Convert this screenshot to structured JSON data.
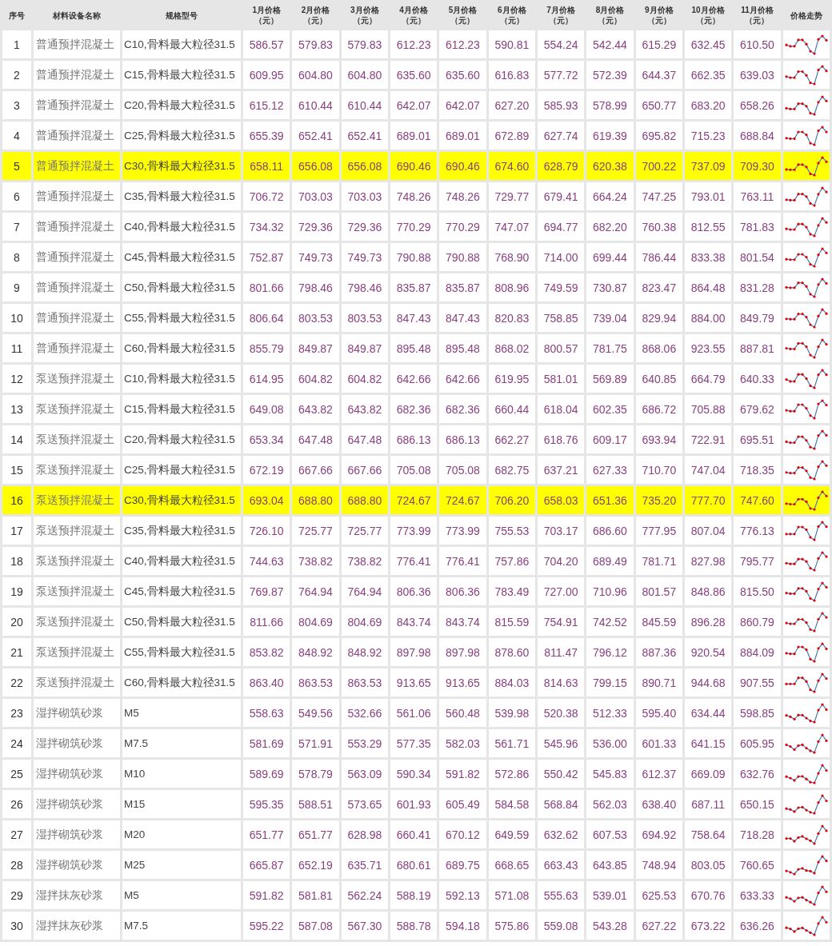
{
  "table": {
    "columns": [
      "序号",
      "材料设备名称",
      "规格型号",
      "1月价格（元）",
      "2月价格（元）",
      "3月价格（元）",
      "4月价格（元）",
      "5月价格（元）",
      "6月价格（元）",
      "7月价格（元）",
      "8月价格（元）",
      "9月价格（元）",
      "10月价格（元）",
      "11月价格（元）",
      "价格走势"
    ],
    "rows": [
      {
        "no": "1",
        "name": "普通预拌混凝土",
        "spec": "C10,骨料最大粒径31.5",
        "highlighted": false,
        "prices": [
          "586.57",
          "579.83",
          "579.83",
          "612.23",
          "612.23",
          "590.81",
          "554.24",
          "542.44",
          "615.29",
          "632.45",
          "610.50"
        ]
      },
      {
        "no": "2",
        "name": "普通预拌混凝土",
        "spec": "C15,骨料最大粒径31.5",
        "highlighted": false,
        "prices": [
          "609.95",
          "604.80",
          "604.80",
          "635.60",
          "635.60",
          "616.83",
          "577.72",
          "572.39",
          "644.37",
          "662.35",
          "639.03"
        ]
      },
      {
        "no": "3",
        "name": "普通预拌混凝土",
        "spec": "C20,骨料最大粒径31.5",
        "highlighted": false,
        "prices": [
          "615.12",
          "610.44",
          "610.44",
          "642.07",
          "642.07",
          "627.20",
          "585.93",
          "578.99",
          "650.77",
          "683.20",
          "658.26"
        ]
      },
      {
        "no": "4",
        "name": "普通预拌混凝土",
        "spec": "C25,骨料最大粒径31.5",
        "highlighted": false,
        "prices": [
          "655.39",
          "652.41",
          "652.41",
          "689.01",
          "689.01",
          "672.89",
          "627.74",
          "619.39",
          "695.82",
          "715.23",
          "688.84"
        ]
      },
      {
        "no": "5",
        "name": "普通预拌混凝土",
        "spec": "C30,骨料最大粒径31.5",
        "highlighted": true,
        "prices": [
          "658.11",
          "656.08",
          "656.08",
          "690.46",
          "690.46",
          "674.60",
          "628.79",
          "620.38",
          "700.22",
          "737.09",
          "709.30"
        ]
      },
      {
        "no": "6",
        "name": "普通预拌混凝土",
        "spec": "C35,骨料最大粒径31.5",
        "highlighted": false,
        "prices": [
          "706.72",
          "703.03",
          "703.03",
          "748.26",
          "748.26",
          "729.77",
          "679.41",
          "664.24",
          "747.25",
          "793.01",
          "763.11"
        ]
      },
      {
        "no": "7",
        "name": "普通预拌混凝土",
        "spec": "C40,骨料最大粒径31.5",
        "highlighted": false,
        "prices": [
          "734.32",
          "729.36",
          "729.36",
          "770.29",
          "770.29",
          "747.07",
          "694.77",
          "682.20",
          "760.38",
          "812.55",
          "781.83"
        ]
      },
      {
        "no": "8",
        "name": "普通预拌混凝土",
        "spec": "C45,骨料最大粒径31.5",
        "highlighted": false,
        "prices": [
          "752.87",
          "749.73",
          "749.73",
          "790.88",
          "790.88",
          "768.90",
          "714.00",
          "699.44",
          "786.44",
          "833.38",
          "801.54"
        ]
      },
      {
        "no": "9",
        "name": "普通预拌混凝土",
        "spec": "C50,骨料最大粒径31.5",
        "highlighted": false,
        "prices": [
          "801.66",
          "798.46",
          "798.46",
          "835.87",
          "835.87",
          "808.96",
          "749.59",
          "730.87",
          "823.47",
          "864.48",
          "831.28"
        ]
      },
      {
        "no": "10",
        "name": "普通预拌混凝土",
        "spec": "C55,骨料最大粒径31.5",
        "highlighted": false,
        "prices": [
          "806.64",
          "803.53",
          "803.53",
          "847.43",
          "847.43",
          "820.83",
          "758.85",
          "739.04",
          "829.94",
          "884.00",
          "849.79"
        ]
      },
      {
        "no": "11",
        "name": "普通预拌混凝土",
        "spec": "C60,骨料最大粒径31.5",
        "highlighted": false,
        "prices": [
          "855.79",
          "849.87",
          "849.87",
          "895.48",
          "895.48",
          "868.02",
          "800.57",
          "781.75",
          "868.06",
          "923.55",
          "887.81"
        ]
      },
      {
        "no": "12",
        "name": "泵送预拌混凝土",
        "spec": "C10,骨料最大粒径31.5",
        "highlighted": false,
        "prices": [
          "614.95",
          "604.82",
          "604.82",
          "642.66",
          "642.66",
          "619.95",
          "581.01",
          "569.89",
          "640.85",
          "664.79",
          "640.33"
        ]
      },
      {
        "no": "13",
        "name": "泵送预拌混凝土",
        "spec": "C15,骨料最大粒径31.5",
        "highlighted": false,
        "prices": [
          "649.08",
          "643.82",
          "643.82",
          "682.36",
          "682.36",
          "660.44",
          "618.04",
          "602.35",
          "686.72",
          "705.88",
          "679.62"
        ]
      },
      {
        "no": "14",
        "name": "泵送预拌混凝土",
        "spec": "C20,骨料最大粒径31.5",
        "highlighted": false,
        "prices": [
          "653.34",
          "647.48",
          "647.48",
          "686.13",
          "686.13",
          "662.27",
          "618.76",
          "609.17",
          "693.94",
          "722.91",
          "695.51"
        ]
      },
      {
        "no": "15",
        "name": "泵送预拌混凝土",
        "spec": "C25,骨料最大粒径31.5",
        "highlighted": false,
        "prices": [
          "672.19",
          "667.66",
          "667.66",
          "705.08",
          "705.08",
          "682.75",
          "637.21",
          "627.33",
          "710.70",
          "747.04",
          "718.35"
        ]
      },
      {
        "no": "16",
        "name": "泵送预拌混凝土",
        "spec": "C30,骨料最大粒径31.5",
        "highlighted": true,
        "prices": [
          "693.04",
          "688.80",
          "688.80",
          "724.67",
          "724.67",
          "706.20",
          "658.03",
          "651.36",
          "735.20",
          "777.70",
          "747.60"
        ]
      },
      {
        "no": "17",
        "name": "泵送预拌混凝土",
        "spec": "C35,骨料最大粒径31.5",
        "highlighted": false,
        "prices": [
          "726.10",
          "725.77",
          "725.77",
          "773.99",
          "773.99",
          "755.53",
          "703.17",
          "686.60",
          "777.95",
          "807.04",
          "776.13"
        ]
      },
      {
        "no": "18",
        "name": "泵送预拌混凝土",
        "spec": "C40,骨料最大粒径31.5",
        "highlighted": false,
        "prices": [
          "744.63",
          "738.82",
          "738.82",
          "776.41",
          "776.41",
          "757.86",
          "704.20",
          "689.49",
          "781.71",
          "827.98",
          "795.77"
        ]
      },
      {
        "no": "19",
        "name": "泵送预拌混凝土",
        "spec": "C45,骨料最大粒径31.5",
        "highlighted": false,
        "prices": [
          "769.87",
          "764.94",
          "764.94",
          "806.36",
          "806.36",
          "783.49",
          "727.00",
          "710.96",
          "801.57",
          "848.86",
          "815.50"
        ]
      },
      {
        "no": "20",
        "name": "泵送预拌混凝土",
        "spec": "C50,骨料最大粒径31.5",
        "highlighted": false,
        "prices": [
          "811.66",
          "804.69",
          "804.69",
          "843.74",
          "843.74",
          "815.59",
          "754.91",
          "742.52",
          "845.59",
          "896.28",
          "860.79"
        ]
      },
      {
        "no": "21",
        "name": "泵送预拌混凝土",
        "spec": "C55,骨料最大粒径31.5",
        "highlighted": false,
        "prices": [
          "853.82",
          "848.92",
          "848.92",
          "897.98",
          "897.98",
          "878.60",
          "811.47",
          "796.12",
          "887.36",
          "920.54",
          "884.09"
        ]
      },
      {
        "no": "22",
        "name": "泵送预拌混凝土",
        "spec": "C60,骨料最大粒径31.5",
        "highlighted": false,
        "prices": [
          "863.40",
          "863.53",
          "863.53",
          "913.65",
          "913.65",
          "884.03",
          "814.63",
          "799.15",
          "890.71",
          "944.68",
          "907.55"
        ]
      },
      {
        "no": "23",
        "name": "湿拌砌筑砂浆",
        "spec": "M5",
        "highlighted": false,
        "prices": [
          "558.63",
          "549.56",
          "532.66",
          "561.06",
          "560.48",
          "539.98",
          "520.38",
          "512.33",
          "595.40",
          "634.44",
          "598.85"
        ]
      },
      {
        "no": "24",
        "name": "湿拌砌筑砂浆",
        "spec": "M7.5",
        "highlighted": false,
        "prices": [
          "581.69",
          "571.91",
          "553.29",
          "577.35",
          "582.03",
          "561.71",
          "545.96",
          "536.00",
          "601.33",
          "641.15",
          "605.95"
        ]
      },
      {
        "no": "25",
        "name": "湿拌砌筑砂浆",
        "spec": "M10",
        "highlighted": false,
        "prices": [
          "589.69",
          "578.79",
          "563.09",
          "590.34",
          "591.82",
          "572.86",
          "550.42",
          "545.83",
          "612.37",
          "669.09",
          "632.76"
        ]
      },
      {
        "no": "26",
        "name": "湿拌砌筑砂浆",
        "spec": "M15",
        "highlighted": false,
        "prices": [
          "595.35",
          "588.51",
          "573.65",
          "601.93",
          "605.49",
          "584.58",
          "568.84",
          "562.03",
          "638.40",
          "687.11",
          "650.15"
        ]
      },
      {
        "no": "27",
        "name": "湿拌砌筑砂浆",
        "spec": "M20",
        "highlighted": false,
        "prices": [
          "651.77",
          "651.77",
          "628.98",
          "660.41",
          "670.12",
          "649.59",
          "632.62",
          "607.53",
          "694.92",
          "758.64",
          "718.28"
        ]
      },
      {
        "no": "28",
        "name": "湿拌砌筑砂浆",
        "spec": "M25",
        "highlighted": false,
        "prices": [
          "665.87",
          "652.19",
          "635.71",
          "680.61",
          "689.75",
          "668.65",
          "663.43",
          "643.85",
          "748.94",
          "803.05",
          "760.65"
        ]
      },
      {
        "no": "29",
        "name": "湿拌抹灰砂浆",
        "spec": "M5",
        "highlighted": false,
        "prices": [
          "591.82",
          "581.81",
          "562.24",
          "588.19",
          "592.13",
          "571.08",
          "555.63",
          "539.01",
          "625.53",
          "670.76",
          "633.33"
        ]
      },
      {
        "no": "30",
        "name": "湿拌抹灰砂浆",
        "spec": "M7.5",
        "highlighted": false,
        "prices": [
          "595.22",
          "587.08",
          "567.30",
          "588.78",
          "594.18",
          "575.86",
          "559.08",
          "543.28",
          "627.22",
          "673.22",
          "636.26"
        ]
      }
    ]
  }
}
